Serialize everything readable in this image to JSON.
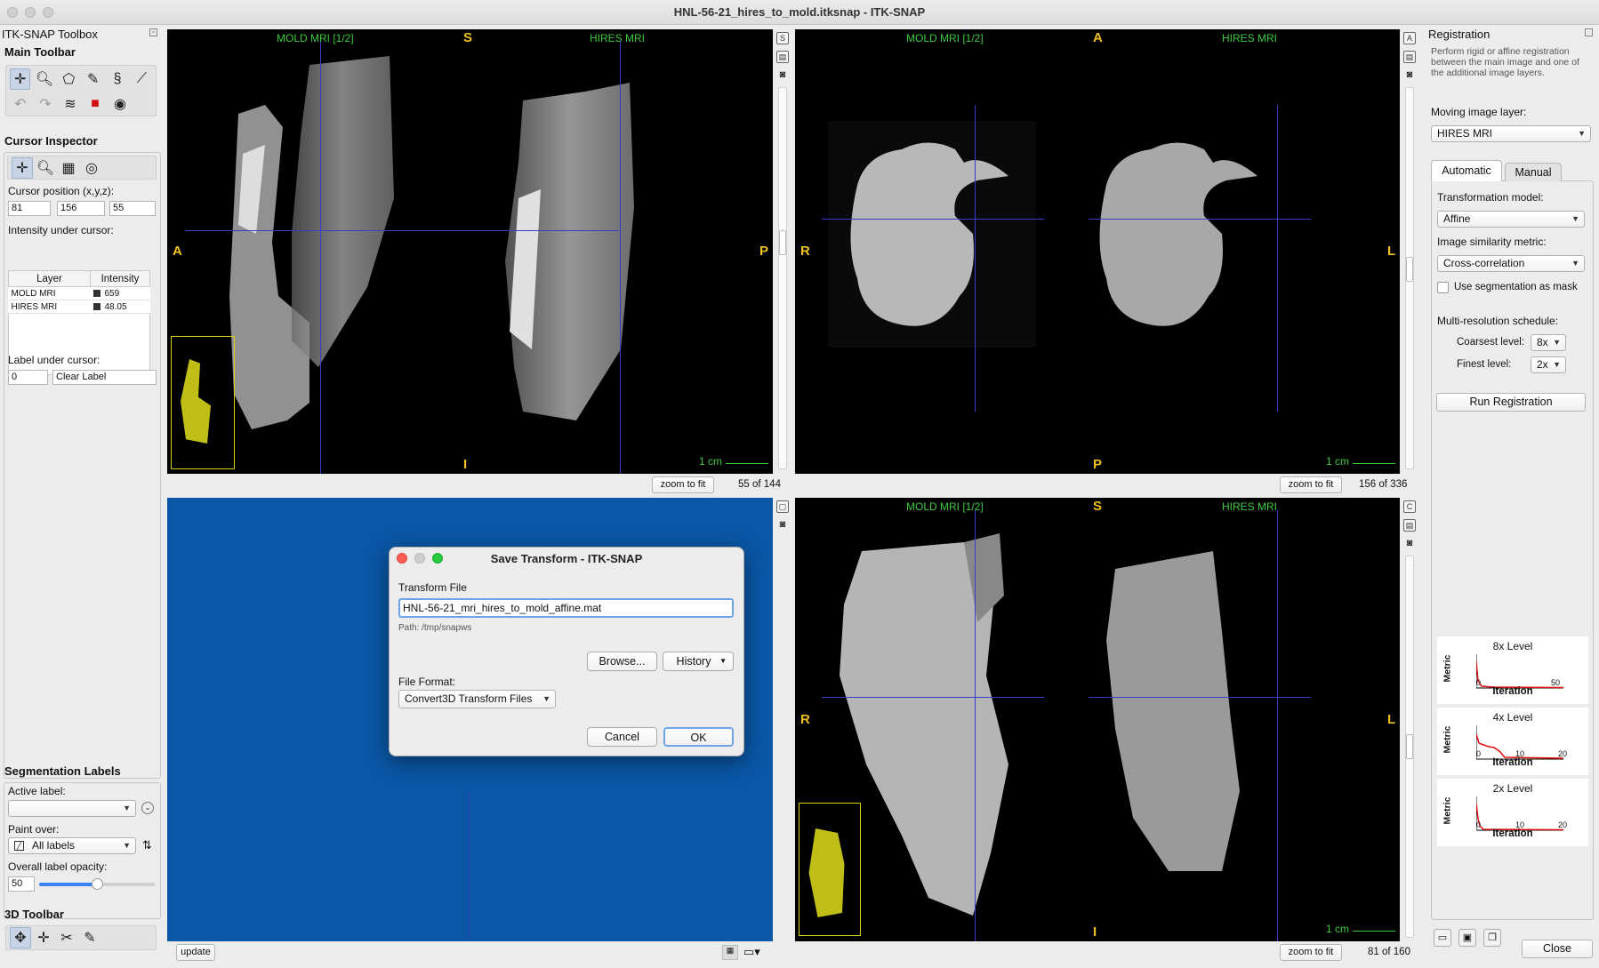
{
  "window": {
    "title": "HNL-56-21_hires_to_mold.itksnap - ITK-SNAP"
  },
  "toolbox": {
    "title": "ITK-SNAP Toolbox",
    "main_toolbar_title": "Main Toolbar",
    "cursor_inspector_title": "Cursor Inspector",
    "cursor_position_label": "Cursor position (x,y,z):",
    "cursor_x": "81",
    "cursor_y": "156",
    "cursor_z": "55",
    "intensity_label": "Intensity under cursor:",
    "table_headers": [
      "Layer",
      "Intensity"
    ],
    "layers": [
      {
        "name": "MOLD MRI",
        "value": "659"
      },
      {
        "name": "HIRES MRI",
        "value": "48.05"
      }
    ],
    "label_under_cursor_title": "Label under cursor:",
    "label_id": "0",
    "label_name": "Clear Label",
    "segmentation_title": "Segmentation Labels",
    "active_label_title": "Active label:",
    "active_label_value": "",
    "paint_over_title": "Paint over:",
    "paint_over_value": "All labels",
    "opacity_title": "Overall label opacity:",
    "opacity_value": "50",
    "opacity_fraction": 0.5,
    "toolbar3d_title": "3D Toolbar"
  },
  "views": {
    "axial": {
      "left_label": "MOLD MRI [1/2]",
      "right_label": "HIRES MRI",
      "top": "S",
      "bottom": "I",
      "left": "A",
      "right": "P",
      "scale": "1 cm",
      "zoom": "zoom to fit",
      "slice": "55 of 144"
    },
    "coronal": {
      "left_label": "MOLD MRI [1/2]",
      "right_label": "HIRES MRI",
      "top": "A",
      "bottom": "P",
      "left": "R",
      "right": "L",
      "scale": "1 cm",
      "zoom": "zoom to fit",
      "slice": "156 of 336"
    },
    "sagittal": {
      "left_label": "MOLD MRI [1/2]",
      "right_label": "HIRES MRI",
      "top": "S",
      "bottom": "I",
      "left": "R",
      "right": "L",
      "scale": "1 cm",
      "zoom": "zoom to fit",
      "slice": "81 of 160"
    },
    "three_d": {
      "update": "update"
    }
  },
  "dialog": {
    "title": "Save Transform - ITK-SNAP",
    "file_label": "Transform File",
    "file_value": "HNL-56-21_mri_hires_to_mold_affine.mat",
    "path": "Path: /tmp/snapws",
    "browse": "Browse...",
    "history": "History",
    "format_label": "File Format:",
    "format_value": "Convert3D Transform Files",
    "cancel": "Cancel",
    "ok": "OK"
  },
  "registration": {
    "title": "Registration",
    "description": "Perform rigid or affine registration between the main image and one of the additional image layers.",
    "moving_label": "Moving image layer:",
    "moving_value": "HIRES MRI",
    "tab_automatic": "Automatic",
    "tab_manual": "Manual",
    "transform_model_label": "Transformation model:",
    "transform_model_value": "Affine",
    "similarity_label": "Image similarity metric:",
    "similarity_value": "Cross-correlation",
    "use_seg_mask": "Use segmentation as mask",
    "use_seg_mask_checked": false,
    "schedule_label": "Multi-resolution schedule:",
    "coarsest_label": "Coarsest level:",
    "coarsest_value": "8x",
    "finest_label": "Finest level:",
    "finest_value": "2x",
    "run_button": "Run Registration",
    "close_button": "Close",
    "plots": [
      {
        "title": "8x Level",
        "ylabel": "Metric",
        "xlabel": "Iteration",
        "ticks": [
          "0",
          "50"
        ]
      },
      {
        "title": "4x Level",
        "ylabel": "Metric",
        "xlabel": "Iteration",
        "ticks": [
          "0",
          "10",
          "20"
        ]
      },
      {
        "title": "2x Level",
        "ylabel": "Metric",
        "xlabel": "Iteration",
        "ticks": [
          "0",
          "10",
          "20"
        ]
      }
    ]
  },
  "colors": {
    "label_green": "#3ecb3e",
    "orient_yellow": "#f0c020",
    "crosshair": "#3b3bd0",
    "view3d_bg": "#0a57a6"
  }
}
